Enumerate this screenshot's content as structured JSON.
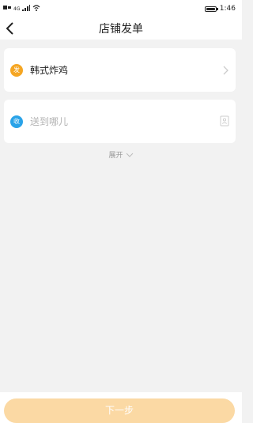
{
  "status_bar": {
    "time": "1:46",
    "left_text": "4G"
  },
  "nav": {
    "title": "店铺发单"
  },
  "sender": {
    "badge": "发",
    "name": "韩式炸鸡"
  },
  "receiver": {
    "badge": "收",
    "placeholder": "送到哪儿"
  },
  "expand": {
    "label": "展开"
  },
  "footer": {
    "next_label": "下一步"
  },
  "colors": {
    "send_badge": "#f5a623",
    "recv_badge": "#2aa3e8",
    "next_button": "#fbd9a4"
  }
}
